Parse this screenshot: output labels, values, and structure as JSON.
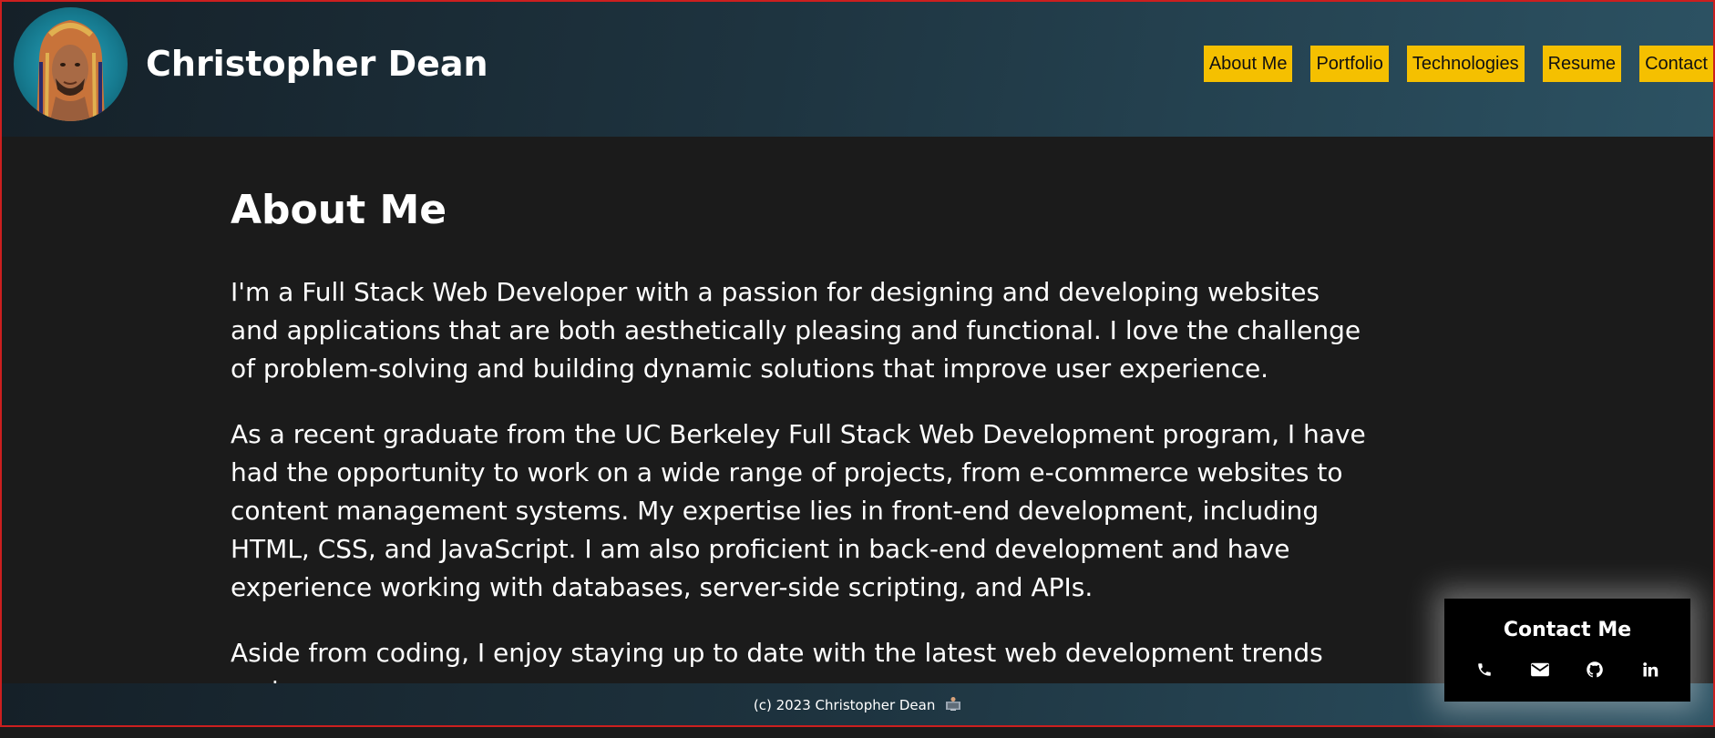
{
  "header": {
    "site_name": "Christopher Dean",
    "nav": [
      "About Me",
      "Portfolio",
      "Technologies",
      "Resume",
      "Contact"
    ]
  },
  "main": {
    "heading": "About Me",
    "paragraphs": [
      "I'm a Full Stack Web Developer with a passion for designing and developing websites and applications that are both aesthetically pleasing and functional. I love the challenge of problem-solving and building dynamic solutions that improve user experience.",
      "As a recent graduate from the UC Berkeley Full Stack Web Development program, I have had the opportunity to work on a wide range of projects, from e-commerce websites to content management systems. My expertise lies in front-end development, including HTML, CSS, and JavaScript. I am also proficient in back-end development and have experience working with databases, server-side scripting, and APIs.",
      "Aside from coding, I enjoy staying up to date with the latest web development trends and"
    ]
  },
  "contact_card": {
    "title": "Contact Me",
    "icons": [
      "phone-icon",
      "email-icon",
      "github-icon",
      "linkedin-icon"
    ]
  },
  "footer": {
    "text": "(c) 2023 Christopher Dean",
    "icon": "computer-user-icon"
  },
  "colors": {
    "nav_button": "#f5c000",
    "background": "#1b1b1b",
    "header_gradient_start": "#152028",
    "header_gradient_end": "#2c5263",
    "frame_border": "#cc1f1f"
  }
}
